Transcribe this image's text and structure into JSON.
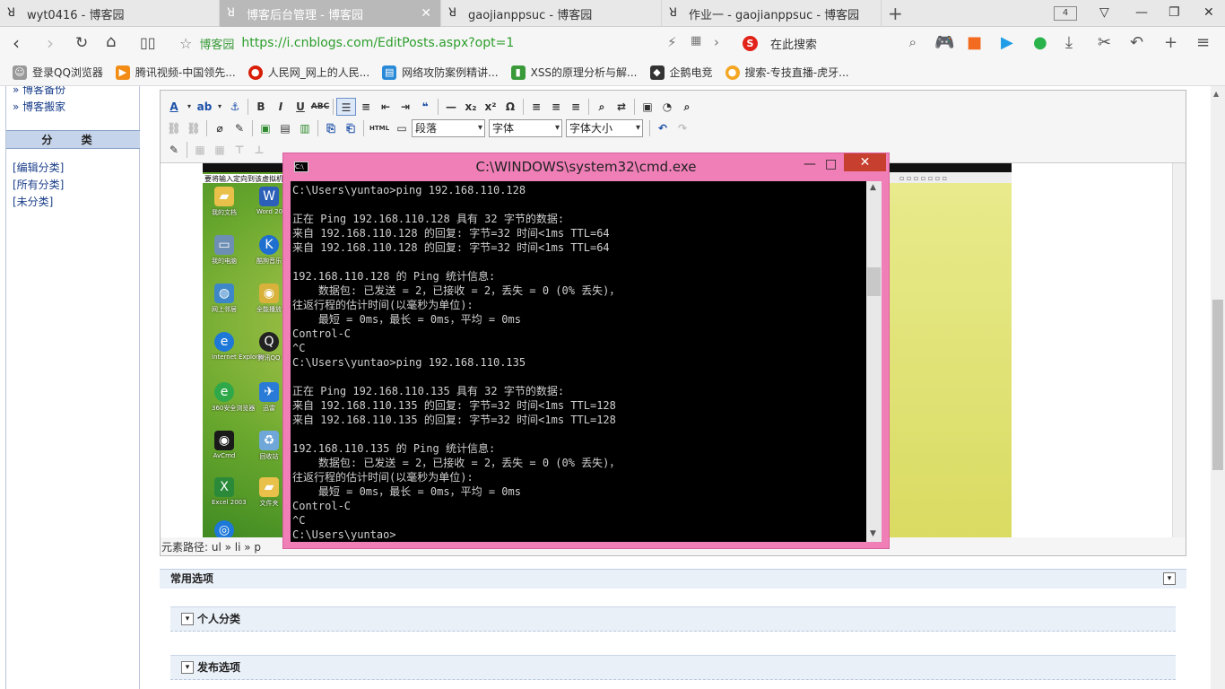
{
  "browser": {
    "tabs": [
      {
        "title": "wyt0416 - 博客园",
        "active": false
      },
      {
        "title": "博客后台管理 - 博客园",
        "active": true
      },
      {
        "title": "gaojianppsuc - 博客园",
        "active": false
      },
      {
        "title": "作业一 - gaojianppsuc - 博客园",
        "active": false
      }
    ],
    "tab_count": "4",
    "site_name": "博客园",
    "url": "https://i.cnblogs.com/EditPosts.aspx?opt=1",
    "search_placeholder": "在此搜索",
    "bookmarks": [
      {
        "label": "登录QQ浏览器",
        "icon": "user-icon",
        "color": "#888888"
      },
      {
        "label": "腾讯视频-中国领先...",
        "icon": "play-icon",
        "color": "#f28c14"
      },
      {
        "label": "人民网_网上的人民...",
        "icon": "people-icon",
        "color": "#d81e06"
      },
      {
        "label": "网络攻防案例精讲...",
        "icon": "page-icon",
        "color": "#2a8ad8"
      },
      {
        "label": "XSS的原理分析与解...",
        "icon": "bars-icon",
        "color": "#3a9a3a"
      },
      {
        "label": "企鹅电竞",
        "icon": "penguin-icon",
        "color": "#333333"
      },
      {
        "label": "搜索-专技直播-虎牙...",
        "icon": "tiger-icon",
        "color": "#f5a623"
      }
    ]
  },
  "sidebar": {
    "links_top": [
      "» 博客备份",
      "» 博客搬家"
    ],
    "category_header": "分 类",
    "category_links": [
      "[编辑分类]",
      "[所有分类]",
      "[未分类]"
    ]
  },
  "editor": {
    "format_select": "段落",
    "font_select": "字体",
    "size_select": "字体大小",
    "html_label": "HTML",
    "element_path": "元素路径: ul » li » p",
    "screenshot_label": "要将输入定向到该虚拟机",
    "desktop_icons": [
      "我的文档",
      "Word 2003",
      "我的电脑",
      "酷狗音乐",
      "网上邻居",
      "全能播放",
      "Internet Explorer",
      "腾讯QQ",
      "360安全浏览器",
      "迅雷",
      "AvCmd",
      "回收站",
      "Excel 2003",
      "文件夹"
    ]
  },
  "panels": {
    "common_options": "常用选项",
    "personal_category": "个人分类",
    "publish_options": "发布选项"
  },
  "cmd": {
    "title": "C:\\WINDOWS\\system32\\cmd.exe",
    "lines": [
      "C:\\Users\\yuntao>ping 192.168.110.128",
      "",
      "正在 Ping 192.168.110.128 具有 32 字节的数据:",
      "来自 192.168.110.128 的回复: 字节=32 时间<1ms TTL=64",
      "来自 192.168.110.128 的回复: 字节=32 时间<1ms TTL=64",
      "",
      "192.168.110.128 的 Ping 统计信息:",
      "    数据包: 已发送 = 2，已接收 = 2，丢失 = 0 (0% 丢失)，",
      "往返行程的估计时间(以毫秒为单位):",
      "    最短 = 0ms，最长 = 0ms，平均 = 0ms",
      "Control-C",
      "^C",
      "C:\\Users\\yuntao>ping 192.168.110.135",
      "",
      "正在 Ping 192.168.110.135 具有 32 字节的数据:",
      "来自 192.168.110.135 的回复: 字节=32 时间<1ms TTL=128",
      "来自 192.168.110.135 的回复: 字节=32 时间<1ms TTL=128",
      "",
      "192.168.110.135 的 Ping 统计信息:",
      "    数据包: 已发送 = 2，已接收 = 2，丢失 = 0 (0% 丢失)，",
      "往返行程的估计时间(以毫秒为单位):",
      "    最短 = 0ms，最长 = 0ms，平均 = 0ms",
      "Control-C",
      "^C",
      "C:\\Users\\yuntao>"
    ]
  }
}
